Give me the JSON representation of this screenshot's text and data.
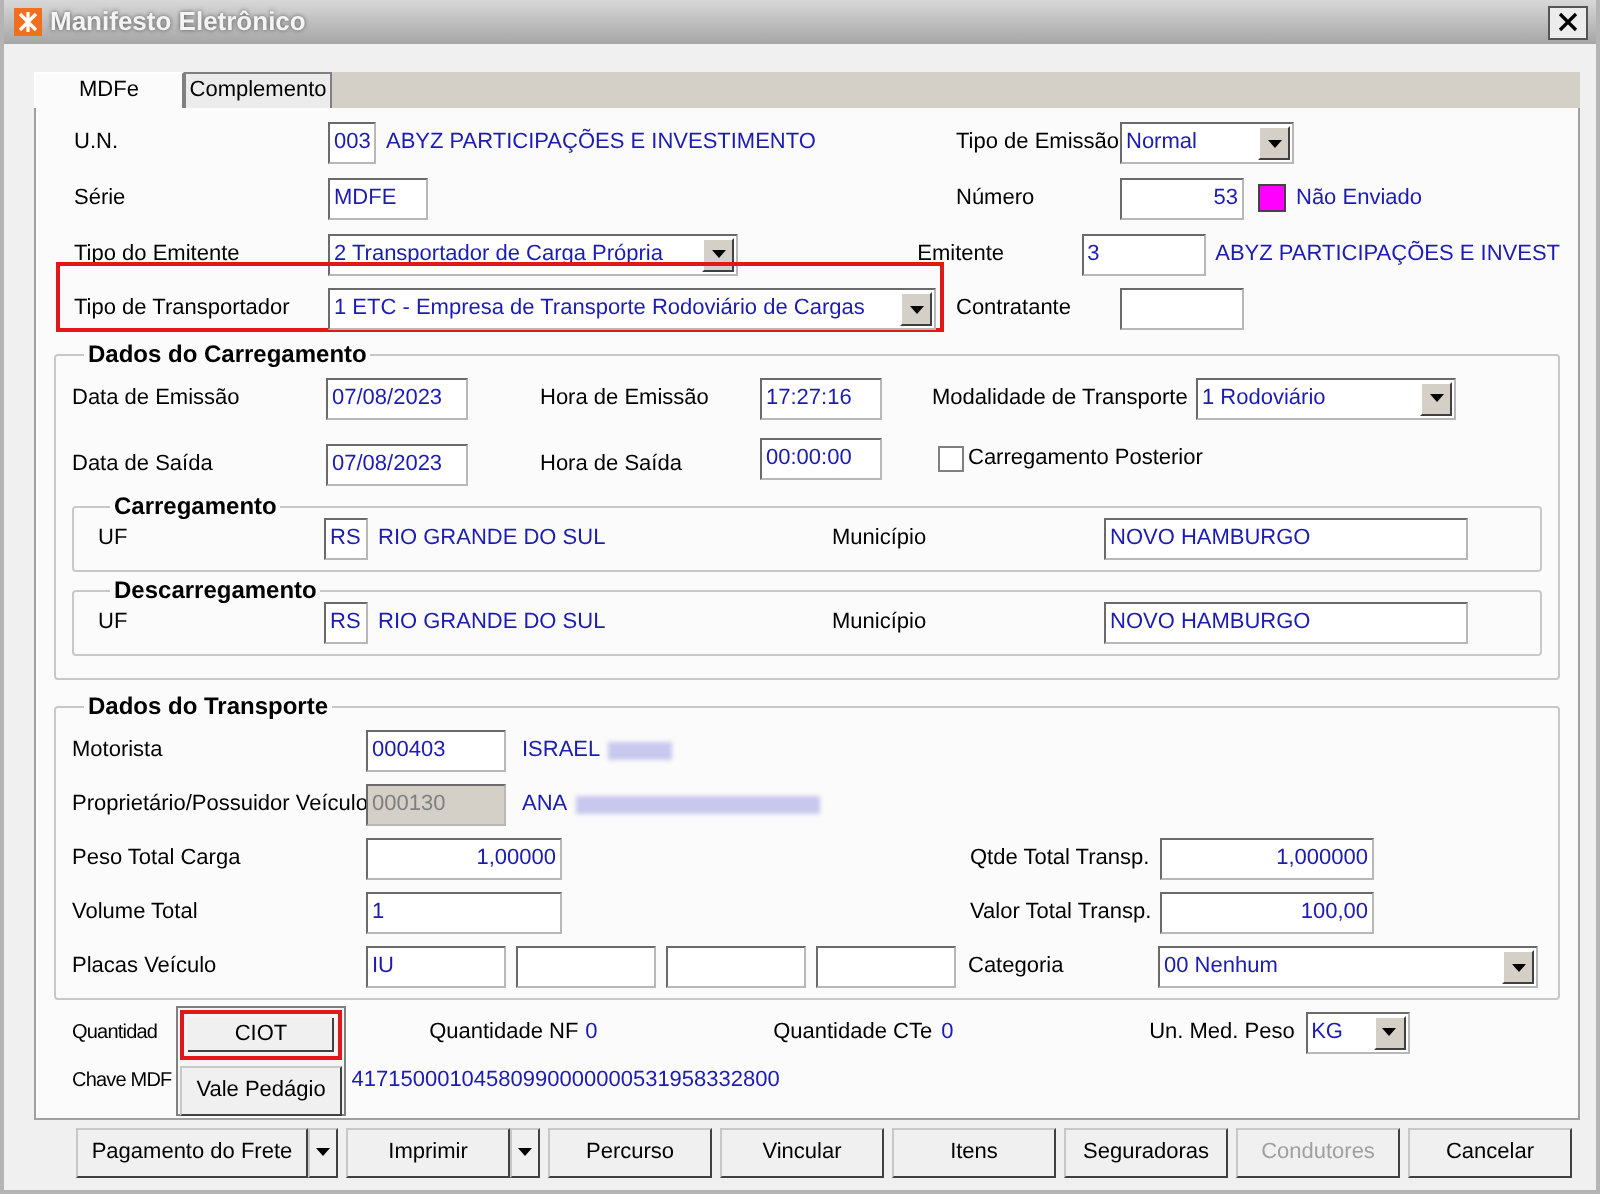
{
  "window": {
    "title": "Manifesto Eletrônico"
  },
  "tabs": [
    {
      "label": "MDFe",
      "selected": true
    },
    {
      "label": "Complemento",
      "selected": false
    }
  ],
  "header": {
    "un": {
      "label": "U.N.",
      "code": "003",
      "name": "ABYZ PARTICIPAÇÕES E INVESTIMENTO"
    },
    "tipo_emissao": {
      "label": "Tipo de Emissão",
      "value": "Normal"
    },
    "serie": {
      "label": "Série",
      "value": "MDFE"
    },
    "numero": {
      "label": "Número",
      "value": "53",
      "status": "Não Enviado"
    },
    "tipo_emitente": {
      "label": "Tipo do Emitente",
      "value": "2 Transportador de Carga Própria"
    },
    "emitente": {
      "label": "Emitente",
      "code": "3",
      "name": "ABYZ PARTICIPAÇÕES E INVEST"
    },
    "tipo_transportador": {
      "label": "Tipo de Transportador",
      "value": "1 ETC - Empresa de Transporte Rodoviário de Cargas",
      "highlighted": true
    },
    "contratante": {
      "label": "Contratante"
    }
  },
  "carregamento": {
    "title": "Dados do Carregamento",
    "data_emissao": {
      "label": "Data de Emissão",
      "value": "07/08/2023"
    },
    "hora_emissao": {
      "label": "Hora de Emissão",
      "value": "17:27:16"
    },
    "modalidade": {
      "label": "Modalidade de Transporte",
      "value": "1 Rodoviário"
    },
    "data_saida": {
      "label": "Data de Saída",
      "value": "07/08/2023"
    },
    "hora_saida": {
      "label": "Hora de Saída",
      "value": "00:00:00"
    },
    "posterior": {
      "label": "Carregamento Posterior",
      "checked": false
    },
    "locais": [
      {
        "title": "Carregamento",
        "uf_label": "UF",
        "uf": "RS",
        "estado": "RIO GRANDE DO SUL",
        "municipio_label": "Município",
        "municipio": "NOVO HAMBURGO"
      },
      {
        "title": "Descarregamento",
        "uf_label": "UF",
        "uf": "RS",
        "estado": "RIO GRANDE DO SUL",
        "municipio_label": "Município",
        "municipio": "NOVO HAMBURGO"
      }
    ]
  },
  "transporte": {
    "title": "Dados do Transporte",
    "motorista": {
      "label": "Motorista",
      "code": "000403",
      "name": "ISRAEL"
    },
    "proprietario": {
      "label": "Proprietário/Possuidor Veículo",
      "code": "000130",
      "name": "ANA",
      "disabled": true
    },
    "peso": {
      "label": "Peso Total Carga",
      "value": "1,00000"
    },
    "qtde": {
      "label": "Qtde Total Transp.",
      "value": "1,000000"
    },
    "volume": {
      "label": "Volume Total",
      "value": "1"
    },
    "valor": {
      "label": "Valor Total Transp.",
      "value": "100,00"
    },
    "placas": {
      "label": "Placas Veículo",
      "fields": [
        {
          "kind": "filled",
          "value": "IU"
        },
        {
          "kind": "empty"
        },
        {
          "kind": "empty"
        },
        {
          "kind": "empty"
        }
      ]
    },
    "categoria": {
      "label": "Categoria",
      "value": "00 Nenhum"
    }
  },
  "footer": {
    "quantidade_label": "Quantidad",
    "nf_label": "Quantidade NF",
    "nf": "0",
    "cte_label": "Quantidade CTe",
    "cte": "0",
    "peso_label": "Un. Med. Peso",
    "peso": "KG",
    "chave_label": "Chave MDF",
    "chave": "41715000104580990000000531958332800"
  },
  "popup_menu": [
    {
      "label": "CIOT",
      "highlighted": true
    },
    {
      "label": "Vale Pedágio",
      "highlighted": false
    }
  ],
  "buttons": [
    {
      "label": "Pagamento do Frete",
      "dropdown": true,
      "disabled": false
    },
    {
      "label": "Imprimir",
      "dropdown": true,
      "disabled": false
    },
    {
      "label": "Percurso",
      "dropdown": false,
      "disabled": false
    },
    {
      "label": "Vincular",
      "dropdown": false,
      "disabled": false
    },
    {
      "label": "Itens",
      "dropdown": false,
      "disabled": false
    },
    {
      "label": "Seguradoras",
      "dropdown": false,
      "disabled": false
    },
    {
      "label": "Condutores",
      "dropdown": false,
      "disabled": true
    },
    {
      "label": "Cancelar",
      "dropdown": false,
      "disabled": false
    }
  ]
}
